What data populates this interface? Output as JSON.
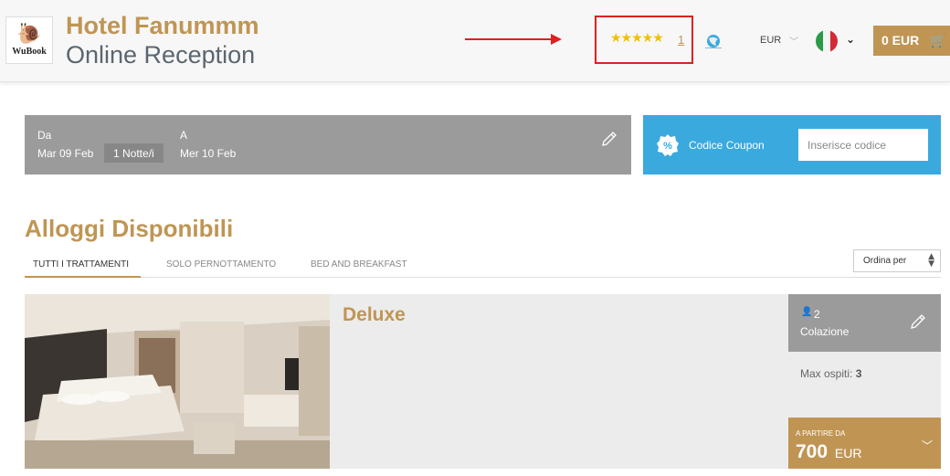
{
  "header": {
    "logo_text": "WuBook",
    "hotel_name": "Hotel Fanummm",
    "subtitle": "Online Reception",
    "rating_stars": "★★★★★",
    "review_count": "1",
    "currency": "EUR",
    "cart_total": "0 EUR",
    "icons": {
      "logo": "snail-logo-icon",
      "globe": "globe-icon",
      "flag": "italy-flag-icon",
      "cart": "cart-icon"
    }
  },
  "search": {
    "from_label": "Da",
    "from_value": "Mar 09 Feb",
    "nights": "1 Notte/i",
    "to_label": "A",
    "to_value": "Mer 10 Feb"
  },
  "coupon": {
    "label": "Codice Coupon",
    "placeholder": "Inserisce codice"
  },
  "section": {
    "title": "Alloggi Disponibili",
    "tabs": [
      {
        "label": "Tutti i trattamenti",
        "active": true
      },
      {
        "label": "Solo pernottamento",
        "active": false
      },
      {
        "label": "Bed and breakfast",
        "active": false
      }
    ],
    "sort_label": "Ordina per"
  },
  "room": {
    "name": "Deluxe",
    "guests": "2",
    "meal": "Colazione",
    "max_guests_label": "Max ospiti:",
    "max_guests_value": "3",
    "price_label": "A partire da",
    "price": "700",
    "price_currency": "EUR"
  },
  "colors": {
    "accent_gold": "#c09553",
    "info_blue": "#3aa9de",
    "panel_gray": "#9b9b9b",
    "annotation_red": "#e02020"
  }
}
